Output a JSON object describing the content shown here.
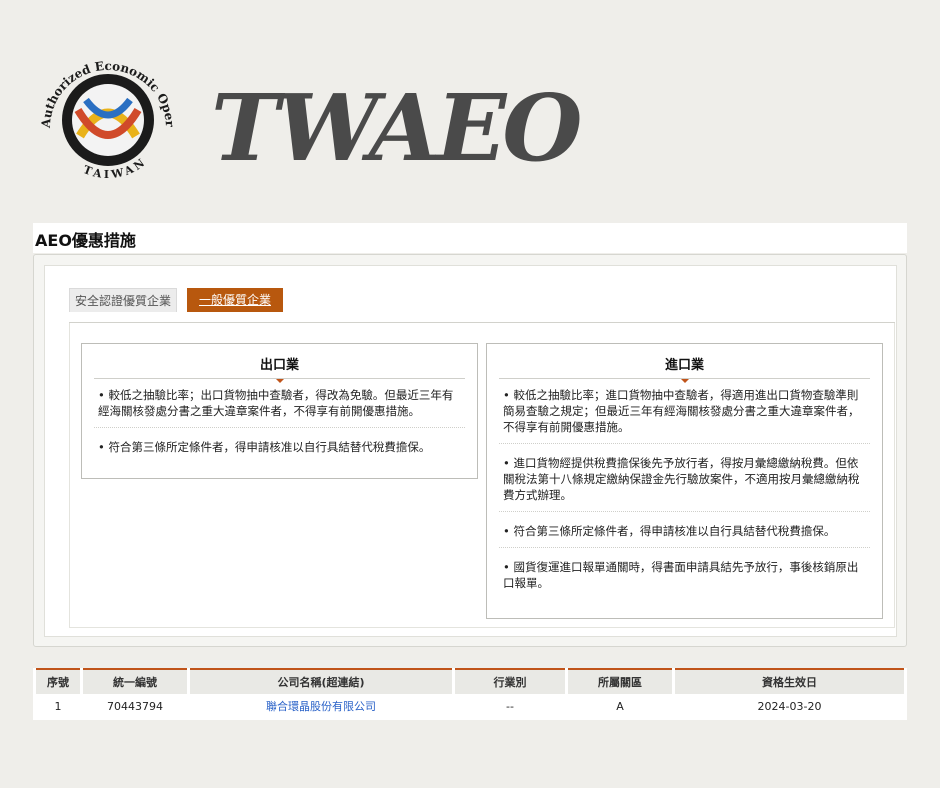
{
  "logo": {
    "seal_text": "Authorized Economic Operator",
    "seal_country": "TAIWAN",
    "wordmark": "TWAEO"
  },
  "section": {
    "title": "AEO優惠措施"
  },
  "tabs": [
    {
      "label": "安全認證優質企業",
      "active": false
    },
    {
      "label": "一般優質企業",
      "active": true
    }
  ],
  "export": {
    "title": "出口業",
    "items": [
      "• 較低之抽驗比率；出口貨物抽中查驗者，得改為免驗。但最近三年有經海關核發處分書之重大違章案件者，不得享有前開優惠措施。",
      "• 符合第三條所定條件者，得申請核准以自行具結替代稅費擔保。"
    ]
  },
  "import": {
    "title": "進口業",
    "items": [
      "• 較低之抽驗比率；進口貨物抽中查驗者，得適用進出口貨物查驗準則簡易查驗之規定；但最近三年有經海關核發處分書之重大違章案件者，不得享有前開優惠措施。",
      "• 進口貨物經提供稅費擔保後先予放行者，得按月彙總繳納稅費。但依關稅法第十八條規定繳納保證金先行驗放案件，不適用按月彙總繳納稅費方式辦理。",
      "• 符合第三條所定條件者，得申請核准以自行具結替代稅費擔保。",
      "• 國貨復運進口報單通關時，得書面申請具結先予放行，事後核銷原出口報單。"
    ]
  },
  "table": {
    "headers": [
      "序號",
      "統一編號",
      "公司名稱(超連結)",
      "行業別",
      "所屬關區",
      "資格生效日"
    ],
    "rows": [
      [
        "1",
        "70443794",
        "聯合環晶股份有限公司",
        "--",
        "A",
        "2024-03-20"
      ]
    ]
  },
  "colors": {
    "accent": "#b8580e",
    "link": "#2a62c8"
  }
}
